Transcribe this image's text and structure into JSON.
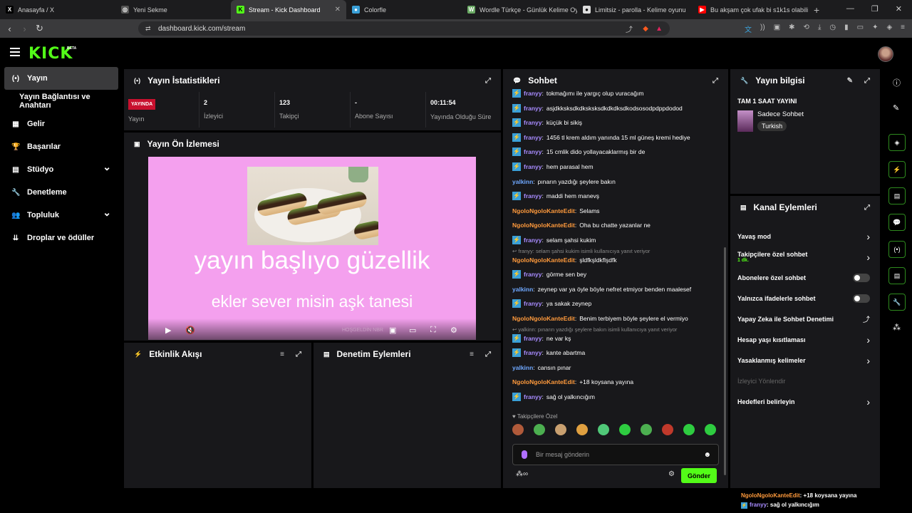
{
  "browser": {
    "tabs": [
      {
        "title": "Anasayfa / X",
        "icon": "x-logo-icon",
        "color": "#000000",
        "glyph": "X"
      },
      {
        "title": "Yeni Sekme",
        "icon": "brave-icon",
        "color": "#555555",
        "glyph": "◎"
      },
      {
        "title": "Stream - Kick Dashboard",
        "icon": "kick-icon",
        "color": "#53fc18",
        "glyph": "K",
        "active": true
      },
      {
        "title": "Colorfle",
        "icon": "colorfle-icon",
        "color": "#3aa0d8",
        "glyph": "●"
      },
      {
        "title": "Wordle Türkçe - Günlük Kelime Oyunu",
        "icon": "wordle-icon",
        "color": "#6aaa64",
        "glyph": "W"
      },
      {
        "title": "Limitsiz - parolla - Kelime oyunu",
        "icon": "parolla-icon",
        "color": "#dddddd",
        "glyph": "●"
      },
      {
        "title": "Bu akşam çok ufak bi s1k1s olabilir",
        "icon": "youtube-icon",
        "color": "#ff0000",
        "glyph": "▶"
      }
    ],
    "url": "dashboard.kick.com/stream"
  },
  "sidebar": {
    "items": [
      {
        "label": "Yayın",
        "icon": "broadcast-icon",
        "glyph": "(•)"
      },
      {
        "label": "Yayın Bağlantısı ve Anahtarı",
        "icon": "",
        "glyph": ""
      },
      {
        "label": "Gelir",
        "icon": "revenue-icon",
        "glyph": "▦"
      },
      {
        "label": "Başarılar",
        "icon": "trophy-icon",
        "glyph": "🏆"
      },
      {
        "label": "Stüdyo",
        "icon": "studio-icon",
        "glyph": "▤"
      },
      {
        "label": "Denetleme",
        "icon": "wrench-icon",
        "glyph": "🔧"
      },
      {
        "label": "Topluluk",
        "icon": "community-icon",
        "glyph": "👥"
      },
      {
        "label": "Droplar ve ödüller",
        "icon": "drops-icon",
        "glyph": "⇊"
      }
    ]
  },
  "stats": {
    "title": "Yayın İstatistikleri",
    "live_badge": "YAYINDA",
    "items": [
      {
        "value": "",
        "label": "Yayın"
      },
      {
        "value": "2",
        "label": "İzleyici"
      },
      {
        "value": "123",
        "label": "Takipçi"
      },
      {
        "value": "-",
        "label": "Abone Sayısı"
      },
      {
        "value": "00:11:54",
        "label": "Yayında Olduğu Süre"
      }
    ]
  },
  "preview": {
    "title": "Yayın Ön İzlemesi",
    "stream_title": "yayın başlıyo güzellik",
    "stream_subtitle": "ekler sever misin aşk tanesi",
    "watermark": "HOŞGELDİN NBR"
  },
  "activity": {
    "title": "Etkinlik Akışı"
  },
  "moderation": {
    "title": "Denetim Eylemleri"
  },
  "chat": {
    "title": "Sohbet",
    "messages": [
      {
        "user": "franyy",
        "text": "tokmağımı ile yargıç olup vuracağım",
        "color": "#a88bff",
        "badge": true
      },
      {
        "user": "franyy",
        "text": "asjdkksksdkdksksksdkdkdksdkodsosodpdppdodod",
        "color": "#a88bff",
        "badge": true
      },
      {
        "user": "franyy",
        "text": "küçük bi sikiş",
        "color": "#a88bff",
        "badge": true
      },
      {
        "user": "franyy",
        "text": "1456 tl krem aldım yanında 15 ml güneş kremi hediye",
        "color": "#a88bff",
        "badge": true
      },
      {
        "user": "franyy",
        "text": "15 cmlik dido yollayacaklarmış bir de",
        "color": "#a88bff",
        "badge": true
      },
      {
        "user": "franyy",
        "text": "hem parasal hem",
        "color": "#a88bff",
        "badge": true
      },
      {
        "user": "yalkinn",
        "text": "pınarın yazdığı şeylere bakın",
        "color": "#6fa8ff",
        "badge": false
      },
      {
        "user": "franyy",
        "text": "maddi hem manevş",
        "color": "#a88bff",
        "badge": true
      },
      {
        "user": "NgoloNgoloKanteEdit",
        "text": "Selams",
        "color": "#ff9a3c",
        "badge": false
      },
      {
        "user": "NgoloNgoloKanteEdit",
        "text": "Oha bu chatte yazanlar ne",
        "color": "#ff9a3c",
        "badge": false
      },
      {
        "user": "franyy",
        "text": "selam şahsi kukim",
        "color": "#a88bff",
        "badge": true
      },
      {
        "reply": "↩ franyy: selam şahsi kukim isimli kullanıcıya yanıt veriyor"
      },
      {
        "user": "NgoloNgoloKanteEdit",
        "text": "şldfkşldkflşdfk",
        "color": "#ff9a3c",
        "badge": false
      },
      {
        "user": "franyy",
        "text": "görme sen bey",
        "color": "#a88bff",
        "badge": true
      },
      {
        "user": "yalkinn",
        "text": "zeynep var ya öyle böyle nefret etmiyor benden maalesef",
        "color": "#6fa8ff",
        "badge": false
      },
      {
        "user": "franyy",
        "text": "ya sakak zeynep",
        "color": "#a88bff",
        "badge": true
      },
      {
        "user": "NgoloNgoloKanteEdit",
        "text": "Benim terbiyem böyle şeylere el vermiyo",
        "color": "#ff9a3c",
        "badge": false
      },
      {
        "reply": "↩ yalkinn: pınarın yazdığı şeylere bakın isimli kullanıcıya yanıt veriyor"
      },
      {
        "user": "franyy",
        "text": "ne var kş",
        "color": "#a88bff",
        "badge": true
      },
      {
        "user": "franyy",
        "text": "kante abartma",
        "color": "#a88bff",
        "badge": true
      },
      {
        "user": "yalkinn",
        "text": "cansın pınar",
        "color": "#6fa8ff",
        "badge": false
      },
      {
        "user": "NgoloNgoloKanteEdit",
        "text": "+18 koysana yayına",
        "color": "#ff9a3c",
        "badge": false
      },
      {
        "user": "franyy",
        "text": "sağ ol yalkıncığım",
        "color": "#a88bff",
        "badge": true
      }
    ],
    "emote_label": "♥ Takipçilere Özel",
    "emote_colors": [
      "#b05a3a",
      "#4caf50",
      "#c9a070",
      "#e0a040",
      "#50c878",
      "#2ecc40",
      "#4caf50",
      "#c0392b",
      "#2ecc40",
      "#2ecc40"
    ],
    "input_placeholder": "Bir mesaj gönderin",
    "send_label": "Gönder"
  },
  "stream_info": {
    "title": "Yayın bilgisi",
    "stream_title": "TAM 1 SAAT YAYINI",
    "category": "Sadece Sohbet",
    "tag": "Turkish"
  },
  "channel_actions": {
    "title": "Kanal Eylemleri",
    "items": [
      {
        "label": "Yavaş mod",
        "control": "arrow"
      },
      {
        "label": "Takipçilere özel sohbet",
        "sub": "1 dk.",
        "control": "arrow"
      },
      {
        "label": "Abonelere özel sohbet",
        "control": "toggle"
      },
      {
        "label": "Yalnızca ifadelerle sohbet",
        "control": "toggle"
      },
      {
        "label": "Yapay Zeka ile Sohbet Denetimi",
        "control": "link"
      },
      {
        "label": "Hesap yaşı kısıtlaması",
        "control": "arrow"
      },
      {
        "label": "Yasaklanmış kelimeler",
        "control": "arrow"
      },
      {
        "label": "İzleyici Yönlendir",
        "control": "none",
        "disabled": true
      },
      {
        "label": "Hedefleri belirleyin",
        "control": "arrow"
      }
    ]
  },
  "overlay_chat": [
    {
      "user": "NgoloNgoloKanteEdit",
      "text": ": +18 koysana yayına",
      "color": "#ff9a3c"
    },
    {
      "user": "franyy",
      "text": ": sağ ol yalkıncığım",
      "color": "#a88bff"
    }
  ]
}
